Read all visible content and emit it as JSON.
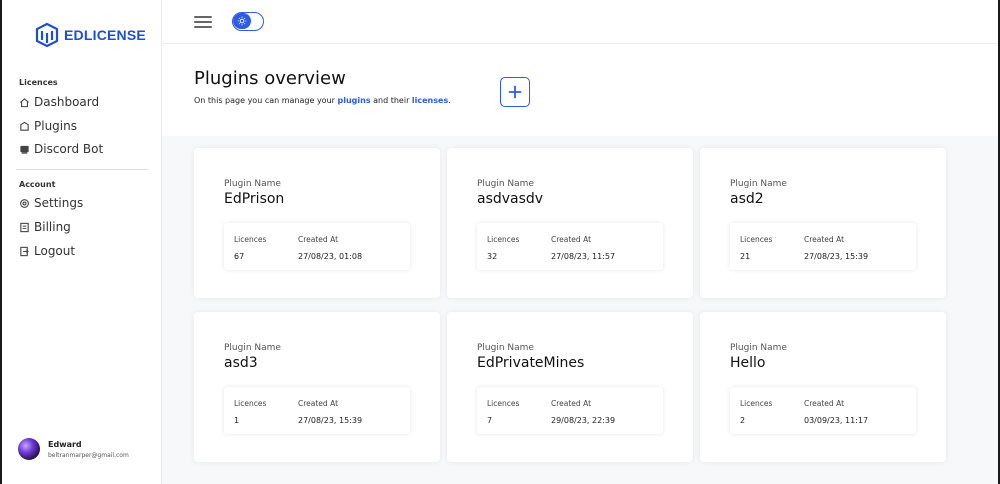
{
  "brand": {
    "name": "EDLICENSE",
    "color": "#1f4fd1"
  },
  "sidebar": {
    "licences_label": "Licences",
    "account_label": "Account",
    "items": [
      {
        "label": "Dashboard",
        "icon": "home-icon"
      },
      {
        "label": "Plugins",
        "icon": "plugin-icon"
      },
      {
        "label": "Discord Bot",
        "icon": "bot-icon"
      },
      {
        "label": "Settings",
        "icon": "gear-icon"
      },
      {
        "label": "Billing",
        "icon": "billing-icon"
      },
      {
        "label": "Logout",
        "icon": "logout-icon"
      }
    ],
    "user": {
      "name": "Edward",
      "email": "beltranmarper@gmail.com"
    }
  },
  "topbar": {
    "menu_icon": "hamburger-icon",
    "theme_toggle_icon": "sun-icon"
  },
  "page": {
    "title": "Plugins overview",
    "subtitle_prefix": "On this page you can manage your ",
    "subtitle_link1": "plugins",
    "subtitle_mid": " and their ",
    "subtitle_link2": "licenses",
    "subtitle_suffix": ".",
    "add_icon": "plus-icon"
  },
  "cards": {
    "name_label": "Plugin Name",
    "licences_label": "Licences",
    "created_label": "Created At",
    "items": [
      {
        "name": "EdPrison",
        "licences": "67",
        "created": "27/08/23, 01:08"
      },
      {
        "name": "asdvasdv",
        "licences": "32",
        "created": "27/08/23, 11:57"
      },
      {
        "name": "asd2",
        "licences": "21",
        "created": "27/08/23, 15:39"
      },
      {
        "name": "asd3",
        "licences": "1",
        "created": "27/08/23, 15:39"
      },
      {
        "name": "EdPrivateMines",
        "licences": "7",
        "created": "29/08/23, 22:39"
      },
      {
        "name": "Hello",
        "licences": "2",
        "created": "03/09/23, 11:17"
      }
    ]
  },
  "colors": {
    "accent": "#2d5be3"
  }
}
